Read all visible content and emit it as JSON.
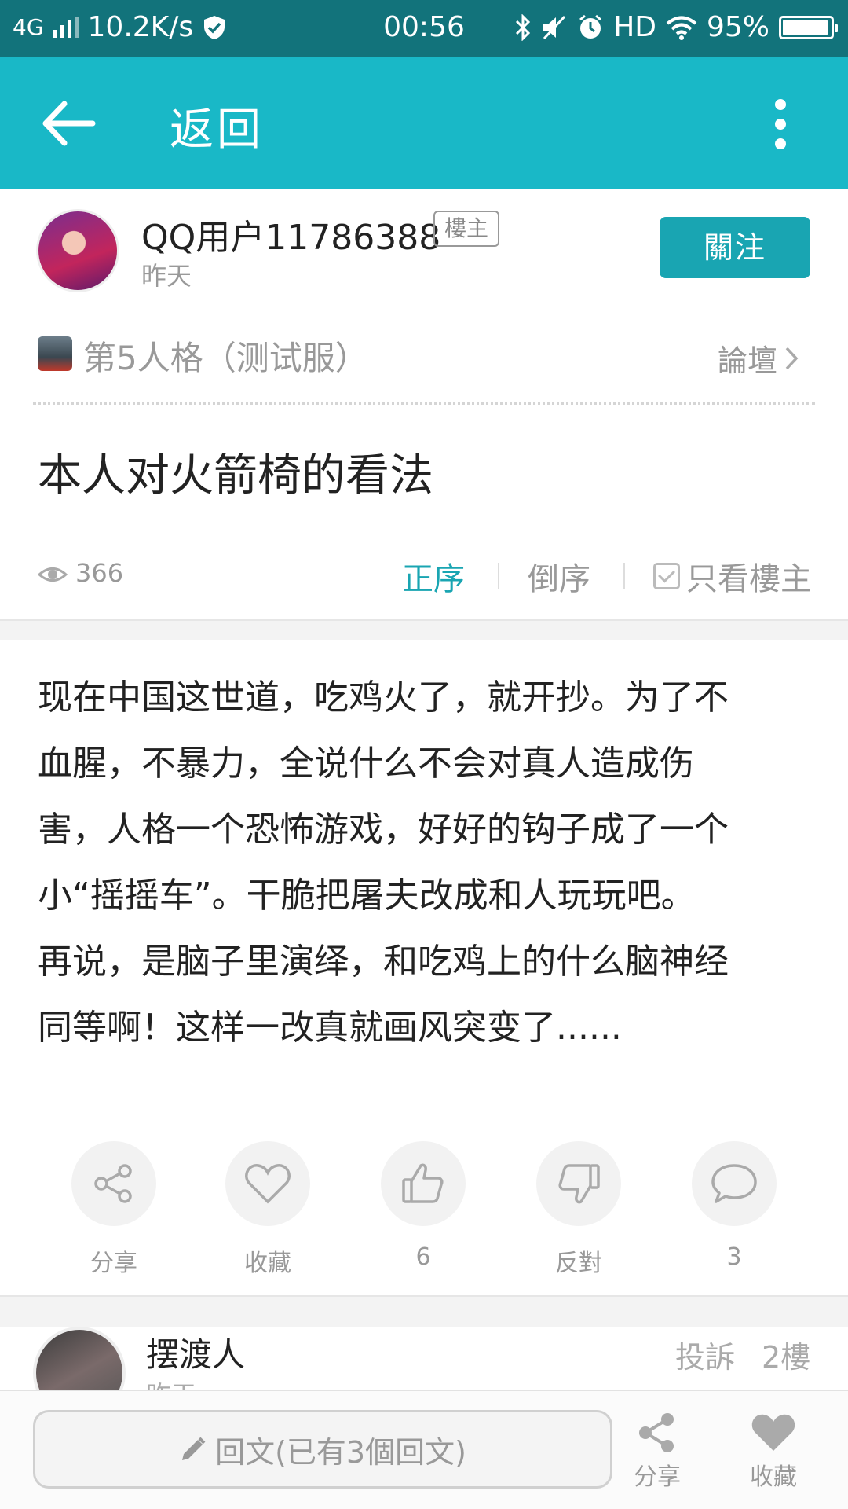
{
  "status_bar": {
    "network": "4G",
    "speed": "10.2K/s",
    "time": "00:56",
    "hd": "HD",
    "battery": "95%",
    "battery_level": 0.95
  },
  "app_bar": {
    "back_label": "返回"
  },
  "author": {
    "name": "QQ用户11786388",
    "badge": "樓主",
    "time": "昨天",
    "follow_label": "關注"
  },
  "forum": {
    "name": "第5人格（测试服）",
    "link_label": "論壇"
  },
  "post": {
    "title": "本人对火箭椅的看法",
    "views": "366",
    "body_lines": [
      "现在中国这世道，吃鸡火了，就开抄。为了不",
      "血腥，不暴力，全说什么不会对真人造成伤",
      "害，人格一个恐怖游戏，好好的钩子成了一个",
      "小“摇摇车”。干脆把屠夫改成和人玩玩吧。",
      "再说，是脑子里演绎，和吃鸡上的什么脑神经",
      "同等啊！这样一改真就画风突变了......"
    ]
  },
  "sort": {
    "asc": "正序",
    "desc": "倒序",
    "op_only": "只看樓主"
  },
  "actions": {
    "share": "分享",
    "favorite": "收藏",
    "like_count": "6",
    "oppose": "反對",
    "comment_count": "3"
  },
  "reply_preview": {
    "name": "摆渡人",
    "time": "昨天",
    "report": "投訴",
    "floor": "2樓"
  },
  "bottom_bar": {
    "reply_placeholder": "回文(已有3個回文)",
    "share": "分享",
    "favorite": "收藏"
  },
  "colors": {
    "status_bar": "#12737b",
    "app_bar": "#19b8c7",
    "accent": "#19a5b2"
  }
}
